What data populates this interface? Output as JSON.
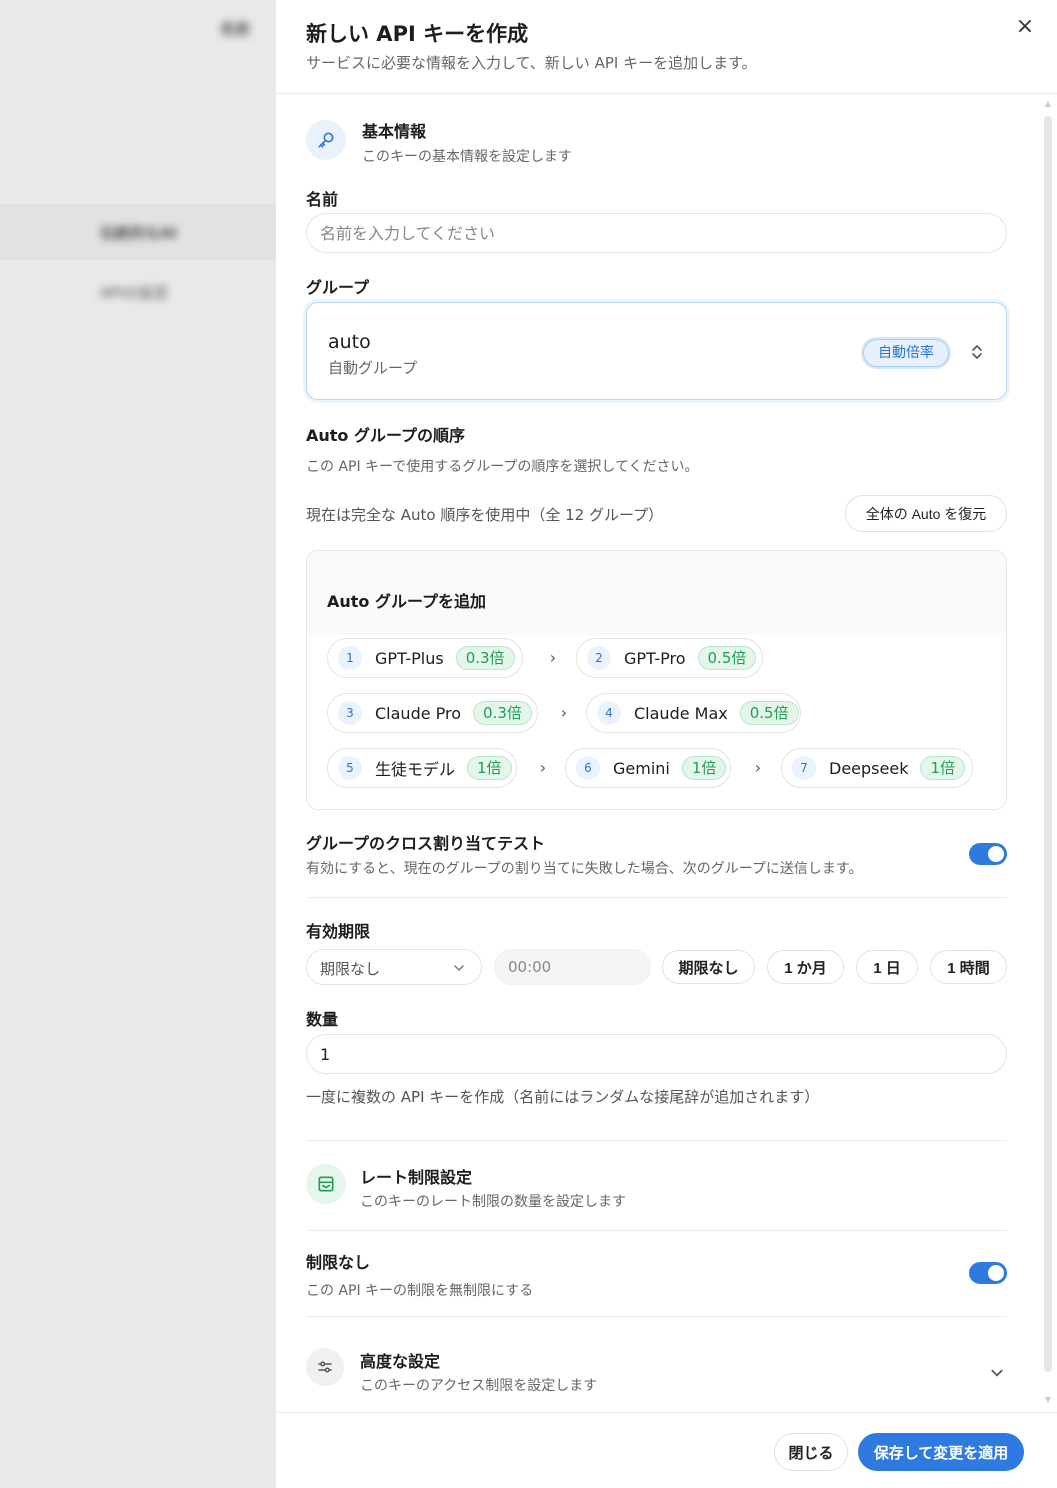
{
  "background": {
    "header_label": "名前",
    "row1": "伝統的なAI",
    "row2": "APIの設定"
  },
  "drawer": {
    "title": "新しい API キーを作成",
    "subtitle": "サービスに必要な情報を入力して、新しい API キーを追加します。",
    "close_label": "×"
  },
  "basic": {
    "title": "基本情報",
    "desc": "このキーの基本情報を設定します"
  },
  "name_field": {
    "label": "名前",
    "placeholder": "名前を入力してください",
    "value": ""
  },
  "group": {
    "label": "グループ",
    "selected_name": "auto",
    "selected_desc": "自動グループ",
    "badge": "自動倍率"
  },
  "auto_order": {
    "title": "Auto グループの順序",
    "desc": "この API キーで使用するグループの順序を選択してください。",
    "status": "現在は完全な Auto 順序を使用中（全 12 グループ）",
    "restore_label": "全体の Auto を復元",
    "add_title": "Auto グループを追加",
    "groups": [
      {
        "num": "1",
        "name": "GPT-Plus",
        "rate": "0.3倍"
      },
      {
        "num": "2",
        "name": "GPT-Pro",
        "rate": "0.5倍"
      },
      {
        "num": "3",
        "name": "Claude Pro",
        "rate": "0.3倍"
      },
      {
        "num": "4",
        "name": "Claude Max",
        "rate": "0.5倍"
      },
      {
        "num": "5",
        "name": "生徒モデル",
        "rate": "1倍"
      },
      {
        "num": "6",
        "name": "Gemini",
        "rate": "1倍"
      },
      {
        "num": "7",
        "name": "Deepseek",
        "rate": "1倍"
      }
    ]
  },
  "cross": {
    "title": "グループのクロス割り当てテスト",
    "desc": "有効にすると、現在のグループの割り当てに失敗した場合、次のグループに送信します。",
    "enabled": true
  },
  "expiry": {
    "label": "有効期限",
    "select_value": "期限なし",
    "time_placeholder": "00:00",
    "quick": [
      "期限なし",
      "1 か月",
      "1 日",
      "1 時間"
    ]
  },
  "quantity": {
    "label": "数量",
    "value": "1",
    "hint": "一度に複数の API キーを作成（名前にはランダムな接尾辞が追加されます）"
  },
  "rate_limit": {
    "title": "レート制限設定",
    "desc": "このキーのレート制限の数量を設定します"
  },
  "unlimited": {
    "title": "制限なし",
    "desc": "この API キーの制限を無制限にする",
    "enabled": true
  },
  "advanced": {
    "title": "高度な設定",
    "desc": "このキーのアクセス制限を設定します"
  },
  "footer": {
    "close_label": "閉じる",
    "save_label": "保存して変更を適用"
  },
  "colors": {
    "accent": "#2f7ae0",
    "rate_green": "#1f9d55"
  }
}
